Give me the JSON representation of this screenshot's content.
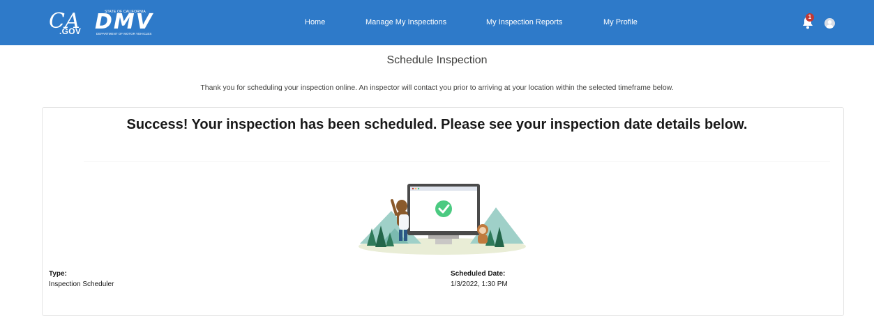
{
  "header": {
    "ca_logo": {
      "mark": "CA",
      "suffix": ".GOV"
    },
    "dmv_logo": {
      "top_text": "STATE OF CALIFORNIA",
      "main_text": "DMV",
      "bottom_text": "DEPARTMENT OF MOTOR VEHICLES"
    },
    "nav": {
      "home": "Home",
      "manage": "Manage My Inspections",
      "reports": "My Inspection Reports",
      "profile": "My Profile"
    },
    "notifications": {
      "count": "1",
      "icon": "bell-icon"
    },
    "user": {
      "icon": "user-avatar-icon"
    }
  },
  "page": {
    "title": "Schedule Inspection",
    "intro": "Thank you for scheduling your inspection online. An inspector will contact you prior to arriving at your location within the selected timeframe below."
  },
  "card": {
    "success_message": "Success! Your inspection has been scheduled. Please see your inspection date details below.",
    "type_label": "Type:",
    "type_value": "Inspection Scheduler",
    "date_label": "Scheduled Date:",
    "date_value": "1/3/2022, 1:30 PM"
  },
  "colors": {
    "header_bg": "#2e7ac9",
    "success_green": "#4bca81",
    "badge_red": "#c23934"
  }
}
